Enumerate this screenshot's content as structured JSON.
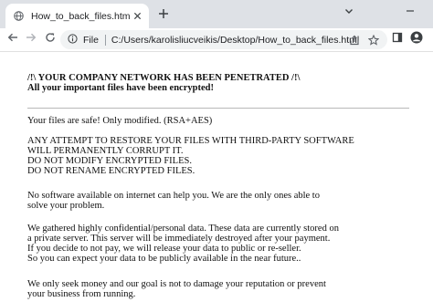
{
  "browser": {
    "tab_title": "How_to_back_files.html",
    "tab_close_symbol": "✕",
    "new_tab_symbol": "+",
    "address": {
      "scheme_label": "File",
      "url": "C:/Users/karolisliucveikis/Desktop/How_to_back_files.html"
    },
    "icons": [
      "globe-icon",
      "close-icon",
      "plus-icon",
      "chevron-down-icon",
      "minimize-icon",
      "back-icon",
      "forward-icon",
      "reload-icon",
      "file-icon",
      "share-icon",
      "star-icon",
      "sidebar-icon",
      "profile-icon"
    ],
    "colors": {
      "tabstrip": "#dee1e6",
      "omnibox": "#f1f3f4",
      "text": "#202124"
    }
  },
  "document": {
    "headline_1": "/!\\ YOUR COMPANY NETWORK HAS BEEN PENETRATED /!\\",
    "headline_2": "All your important files have been encrypted!",
    "p1": "Your files are safe! Only modified. (RSA+AES)",
    "p2_lines": [
      "ANY ATTEMPT TO RESTORE YOUR FILES WITH THIRD-PARTY SOFTWARE",
      "WILL PERMANENTLY CORRUPT IT.",
      "DO NOT MODIFY ENCRYPTED FILES.",
      "DO NOT RENAME ENCRYPTED FILES."
    ],
    "p3_lines": [
      "No software available on internet can help you. We are the only ones able to",
      "solve your problem."
    ],
    "p4_lines": [
      "We gathered highly confidential/personal data. These data are currently stored on",
      "a private server. This server will be immediately destroyed after your payment.",
      "If you decide to not pay, we will release your data to public or re-seller.",
      "So you can expect your data to be publicly available in the near future.."
    ],
    "p5_lines": [
      "We only seek money and our goal is not to damage your reputation or prevent",
      "your business from running."
    ]
  }
}
